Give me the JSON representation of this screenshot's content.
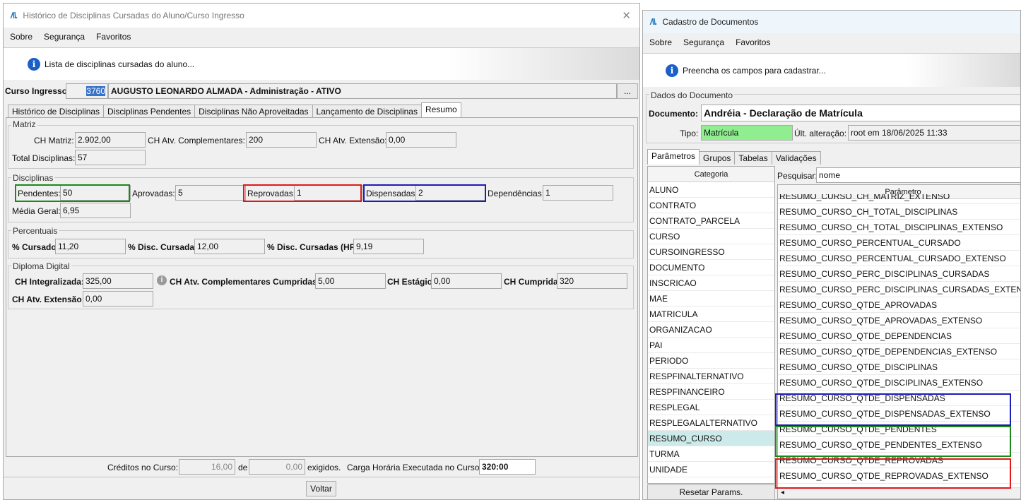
{
  "left": {
    "title": "Histórico de Disciplinas Cursadas do Aluno/Curso Ingresso",
    "menu": [
      "Sobre",
      "Segurança",
      "Favoritos"
    ],
    "info": "Lista de disciplinas cursadas do aluno...",
    "curso_label": "Curso Ingresso:",
    "curso_code": "3760",
    "curso_desc": "AUGUSTO LEONARDO ALMADA - Administração - ATIVO",
    "lookup_btn": "...",
    "tabs": [
      "Histórico de Disciplinas",
      "Disciplinas Pendentes",
      "Disciplinas Não Aproveitadas",
      "Lançamento de Disciplinas",
      "Resumo"
    ],
    "matriz": {
      "title": "Matriz",
      "ch_matriz_label": "CH Matriz:",
      "ch_matriz": "2.902,00",
      "ch_atv_label": "CH Atv. Complementares:",
      "ch_atv": "200",
      "ch_ext_label": "CH Atv. Extensão:",
      "ch_ext": "0,00",
      "total_label": "Total Disciplinas:",
      "total": "57"
    },
    "disciplinas": {
      "title": "Disciplinas",
      "pendentes_label": "Pendentes:",
      "pendentes": "50",
      "aprovadas_label": "Aprovadas:",
      "aprovadas": "5",
      "reprovadas_label": "Reprovadas:",
      "reprovadas": "1",
      "dispensadas_label": "Dispensadas:",
      "dispensadas": "2",
      "dependencias_label": "Dependências:",
      "dependencias": "1",
      "media_label": "Média Geral:",
      "media": "6,95"
    },
    "percentuais": {
      "title": "Percentuais",
      "cursado_label": "% Cursado:",
      "cursado": "11,20",
      "disc_label": "% Disc. Cursadas:",
      "disc": "12,00",
      "disc_hr_label": "% Disc. Cursadas (HR):",
      "disc_hr": "9,19"
    },
    "diploma": {
      "title": "Diploma Digital",
      "ch_int_label": "CH Integralizada:",
      "ch_int": "325,00",
      "ch_comp_label": "CH Atv. Complementares Cumpridas:",
      "ch_comp": "5,00",
      "ch_estagio_label": "CH Estágio:",
      "ch_estagio": "0,00",
      "ch_cumprida_label": "CH Cumprida:",
      "ch_cumprida": "320",
      "ch_ext_label": "CH Atv. Extensão:",
      "ch_ext": "0,00"
    },
    "footer": {
      "creditos_label": "Créditos no Curso:",
      "creditos": "16,00",
      "de": "de",
      "exigidos_val": "0,00",
      "exigidos": "exigidos.",
      "carga_label": "Carga Horária Executada no Curso:",
      "carga": "320:00"
    },
    "voltar": "Voltar"
  },
  "right": {
    "title": "Cadastro de Documentos",
    "menu": [
      "Sobre",
      "Segurança",
      "Favoritos"
    ],
    "info": "Preencha os campos para cadastrar...",
    "dados_title": "Dados do Documento",
    "documento_label": "Documento:",
    "documento": "Andréia - Declaração de Matrícula",
    "tipo_label": "Tipo:",
    "tipo": "Matrícula",
    "ult_label": "Últ. alteração:",
    "ult": "root em 18/06/2025 11:33",
    "tabs": [
      "Parâmetros",
      "Grupos",
      "Tabelas",
      "Validações"
    ],
    "categoria_header": "Categoria",
    "categorias": [
      "ALUNO",
      "CONTRATO",
      "CONTRATO_PARCELA",
      "CURSO",
      "CURSOINGRESSO",
      "DOCUMENTO",
      "INSCRICAO",
      "MAE",
      "MATRICULA",
      "ORGANIZACAO",
      "PAI",
      "PERIODO",
      "RESPFINALTERNATIVO",
      "RESPFINANCEIRO",
      "RESPLEGAL",
      "RESPLEGALALTERNATIVO",
      "RESUMO_CURSO",
      "TURMA",
      "UNIDADE"
    ],
    "selected_categoria": "RESUMO_CURSO",
    "pesquisar_label": "Pesquisar:",
    "pesquisar": "nome",
    "parametro_header": "Parâmetro",
    "parametros": [
      "RESUMO_CURSO_CH_MATRIZ_EXTENSO",
      "RESUMO_CURSO_CH_TOTAL_DISCIPLINAS",
      "RESUMO_CURSO_CH_TOTAL_DISCIPLINAS_EXTENSO",
      "RESUMO_CURSO_PERCENTUAL_CURSADO",
      "RESUMO_CURSO_PERCENTUAL_CURSADO_EXTENSO",
      "RESUMO_CURSO_PERC_DISCIPLINAS_CURSADAS",
      "RESUMO_CURSO_PERC_DISCIPLINAS_CURSADAS_EXTENSO",
      "RESUMO_CURSO_QTDE_APROVADAS",
      "RESUMO_CURSO_QTDE_APROVADAS_EXTENSO",
      "RESUMO_CURSO_QTDE_DEPENDENCIAS",
      "RESUMO_CURSO_QTDE_DEPENDENCIAS_EXTENSO",
      "RESUMO_CURSO_QTDE_DISCIPLINAS",
      "RESUMO_CURSO_QTDE_DISCIPLINAS_EXTENSO",
      "RESUMO_CURSO_QTDE_DISPENSADAS",
      "RESUMO_CURSO_QTDE_DISPENSADAS_EXTENSO",
      "RESUMO_CURSO_QTDE_PENDENTES",
      "RESUMO_CURSO_QTDE_PENDENTES_EXTENSO",
      "RESUMO_CURSO_QTDE_REPROVADAS",
      "RESUMO_CURSO_QTDE_REPROVADAS_EXTENSO"
    ],
    "resetar": "Resetar Params."
  },
  "colors": {
    "highlight_green": "#1a8a1a",
    "highlight_red": "#e01818",
    "highlight_blue": "#1c1cb6",
    "tipo_bg": "#90ee90",
    "selected_row": "#cdeaea"
  }
}
